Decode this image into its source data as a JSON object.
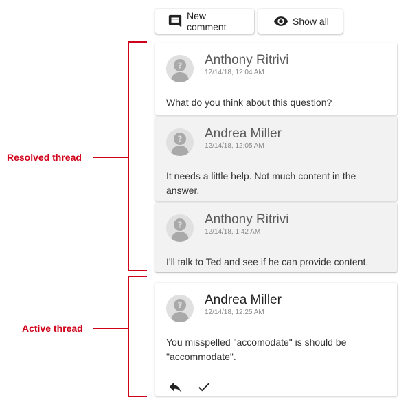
{
  "toolbar": {
    "new_comment_label": "New comment",
    "show_all_label": "Show all"
  },
  "resolved_thread": {
    "label": "Resolved thread",
    "comments": [
      {
        "author": "Anthony Ritrivi",
        "time": "12/14/18, 12:04 AM",
        "text": "What do you think about this question?"
      },
      {
        "author": "Andrea Miller",
        "time": "12/14/18, 12:05 AM",
        "text": "It needs a little help. Not much content in the answer."
      },
      {
        "author": "Anthony Ritrivi",
        "time": "12/14/18, 1:42 AM",
        "text": "I'll talk to Ted and see if he can provide content."
      }
    ]
  },
  "active_thread": {
    "label": "Active thread",
    "comments": [
      {
        "author": "Andrea Miller",
        "time": "12/14/18, 12:25 AM",
        "text": "You misspelled \"accomodate\" is should be \"accommodate\"."
      }
    ]
  },
  "colors": {
    "annotation": "#d0021b",
    "resolved_card_bg": "#f2f2f2",
    "avatar_bg": "#e0e0e0",
    "avatar_fg": "#a9a9a9"
  },
  "icons": {
    "new_comment": "comment-icon",
    "show_all": "eye-icon",
    "avatar": "unknown-user-icon",
    "reply": "reply-icon",
    "resolve": "check-icon"
  }
}
